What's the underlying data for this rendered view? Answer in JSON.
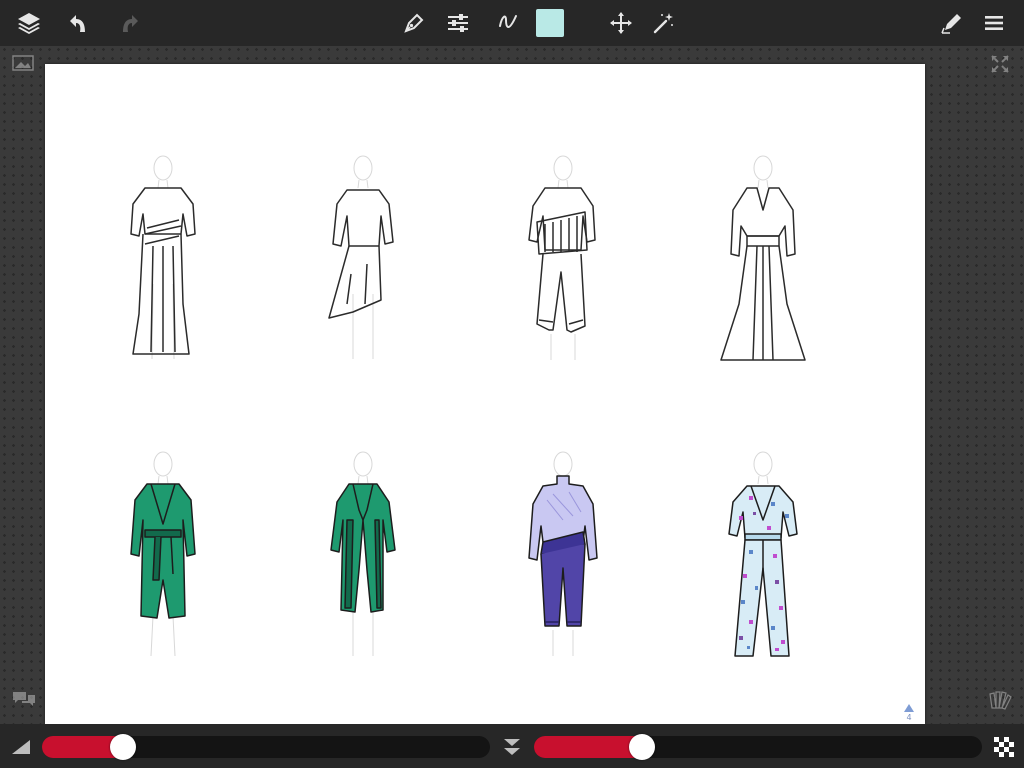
{
  "app": {
    "toolbar": {
      "icons": [
        "layers-icon",
        "undo-icon",
        "redo-icon",
        "pen-tool-icon",
        "brush-settings-icon",
        "stroke-icon",
        "color-swatch",
        "move-icon",
        "magic-wand-icon",
        "edit-icon",
        "menu-icon"
      ],
      "swatch_color": "#b9e9e6"
    },
    "canvas": {
      "page_indicator": "4"
    },
    "bottom_bar": {
      "size_slider": {
        "level": 0.18,
        "fill_color": "#c8102e"
      },
      "opacity_slider": {
        "level": 0.24,
        "fill_color": "#c8102e"
      },
      "icons": [
        "brush-size-icon",
        "collapse-icon",
        "opacity-checker-icon"
      ]
    },
    "colors": {
      "toolbar_bg": "#272727",
      "canvas_bg": "#ffffff",
      "accent": "#c8102e",
      "green_fill": "#1e9a6f",
      "purple_fill": "#5145a8",
      "lavender_fill": "#c9c8f2"
    }
  }
}
